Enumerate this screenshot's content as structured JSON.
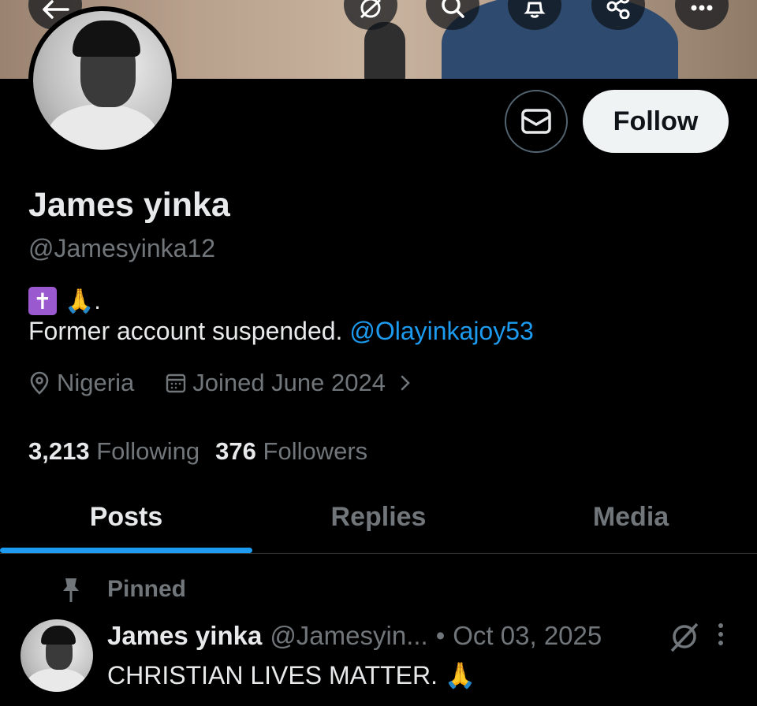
{
  "header": {
    "back_icon": "arrow-left-icon",
    "actions": [
      "grok-icon",
      "search-icon",
      "bell-icon",
      "share-icon",
      "more-icon"
    ]
  },
  "profile": {
    "name": "James yinka",
    "handle": "@Jamesyinka12",
    "bio_line1_emoji": "✝️ 🙏.",
    "bio_cross": "✝",
    "bio_pray": "🙏.",
    "bio_text": "Former account suspended. ",
    "bio_mention": "@Olayinkajoy53",
    "location": "Nigeria",
    "joined": "Joined June 2024",
    "following_count": "3,213",
    "following_label": "Following",
    "followers_count": "376",
    "followers_label": "Followers"
  },
  "buttons": {
    "follow_label": "Follow"
  },
  "tabs": [
    {
      "label": "Posts",
      "active": true
    },
    {
      "label": "Replies",
      "active": false
    },
    {
      "label": "Media",
      "active": false
    }
  ],
  "post": {
    "pinned_label": "Pinned",
    "author_name": "James yinka",
    "author_handle": "@Jamesyin...",
    "separator": "•",
    "date": "Oct 03, 2025",
    "text": "CHRISTIAN LIVES MATTER. 🙏"
  },
  "colors": {
    "accent": "#1d9bf0",
    "muted": "#71767b",
    "cross_badge": "#9b59d0"
  }
}
